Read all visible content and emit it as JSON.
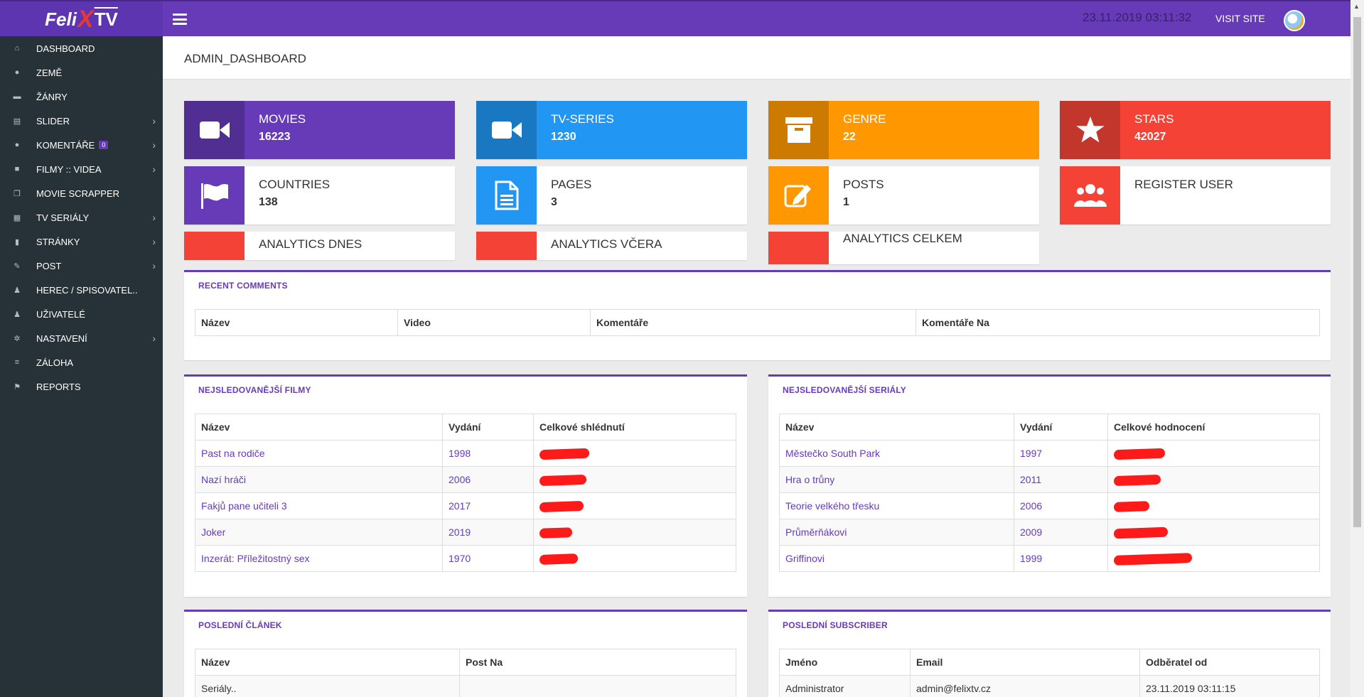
{
  "brand": {
    "part1": "Feli",
    "part2": "X",
    "part3": "TV"
  },
  "topbar": {
    "datetime": "23.11.2019 03:11:32",
    "visit_site": "VISIT SITE"
  },
  "sidebar": {
    "items": [
      {
        "label": "DASHBOARD",
        "icon": "home-icon",
        "arrow": false
      },
      {
        "label": "ZEMĚ",
        "icon": "globe-icon",
        "arrow": false
      },
      {
        "label": "ŽÁNRY",
        "icon": "archive-icon",
        "arrow": false
      },
      {
        "label": "SLIDER",
        "icon": "sliders-icon",
        "arrow": true
      },
      {
        "label": "KOMENTÁŘE",
        "icon": "comment-icon",
        "arrow": true,
        "badge": "0"
      },
      {
        "label": "FILMY :: VIDEA",
        "icon": "video-icon",
        "arrow": true
      },
      {
        "label": "MOVIE SCRAPPER",
        "icon": "copy-icon",
        "arrow": false
      },
      {
        "label": "TV SERIÁLY",
        "icon": "film-icon",
        "arrow": true
      },
      {
        "label": "STRÁNKY",
        "icon": "file-icon",
        "arrow": true
      },
      {
        "label": "POST",
        "icon": "edit-icon",
        "arrow": true
      },
      {
        "label": "HEREC / SPISOVATEL..",
        "icon": "users-icon",
        "arrow": false
      },
      {
        "label": "UŽIVATELÉ",
        "icon": "user-icon",
        "arrow": false
      },
      {
        "label": "NASTAVENÍ",
        "icon": "cogs-icon",
        "arrow": true
      },
      {
        "label": "ZÁLOHA",
        "icon": "database-icon",
        "arrow": false
      },
      {
        "label": "REPORTS",
        "icon": "flag-icon",
        "arrow": false
      }
    ]
  },
  "page_title": "ADMIN_DASHBOARD",
  "info_boxes": {
    "movies": {
      "label": "MOVIES",
      "value": "16223"
    },
    "tvseries": {
      "label": "TV-SERIES",
      "value": "1230"
    },
    "genre": {
      "label": "GENRE",
      "value": "22"
    },
    "stars": {
      "label": "STARS",
      "value": "42027"
    },
    "countries": {
      "label": "COUNTRIES",
      "value": "138"
    },
    "pages": {
      "label": "PAGES",
      "value": "3"
    },
    "posts": {
      "label": "POSTS",
      "value": "1"
    },
    "register": {
      "label": "REGISTER USER"
    },
    "an_today": {
      "label": "ANALYTICS DNES"
    },
    "an_yesterday": {
      "label": "ANALYTICS VČERA"
    },
    "an_total": {
      "label": "ANALYTICS CELKEM"
    }
  },
  "colors": {
    "purple": "#673ab7",
    "blue": "#2196f3",
    "orange": "#ff9800",
    "red": "#f44336",
    "sidebar": "#263238"
  },
  "recent_comments": {
    "title": "RECENT COMMENTS",
    "headers": [
      "Název",
      "Video",
      "Komentáře",
      "Komentáře Na"
    ]
  },
  "top_movies": {
    "title": "NEJSLEDOVANĚJŠÍ FILMY",
    "headers": [
      "Název",
      "Vydání",
      "Celkové shlédnutí"
    ],
    "rows": [
      {
        "name": "Past na rodiče",
        "year": "1998"
      },
      {
        "name": "Nazí hráči",
        "year": "2006"
      },
      {
        "name": "Fakjů pane učiteli 3",
        "year": "2017"
      },
      {
        "name": "Joker",
        "year": "2019"
      },
      {
        "name": "Inzerát: Příležitostný sex",
        "year": "1970"
      }
    ]
  },
  "top_series": {
    "title": "NEJSLEDOVANĚJŠÍ SERIÁLY",
    "headers": [
      "Název",
      "Vydání",
      "Celkové hodnocení"
    ],
    "rows": [
      {
        "name": "Městečko South Park",
        "year": "1997"
      },
      {
        "name": "Hra o trůny",
        "year": "2011"
      },
      {
        "name": "Teorie velkého třesku",
        "year": "2006"
      },
      {
        "name": "Průměrňákovi",
        "year": "2009"
      },
      {
        "name": "Griffinovi",
        "year": "1999"
      }
    ]
  },
  "last_article": {
    "title": "POSLEDNÍ ČLÁNEK",
    "headers": [
      "Název",
      "Post Na"
    ],
    "rows": [
      {
        "name": "Seriály..",
        "post_on": ""
      }
    ]
  },
  "last_subscriber": {
    "title": "POSLEDNÍ SUBSCRIBER",
    "headers": [
      "Jméno",
      "Email",
      "Odběratel od"
    ],
    "rows": [
      {
        "name": "Administrator",
        "email": "admin@felixtv.cz",
        "since": "23.11.2019 03:11:15"
      }
    ]
  }
}
